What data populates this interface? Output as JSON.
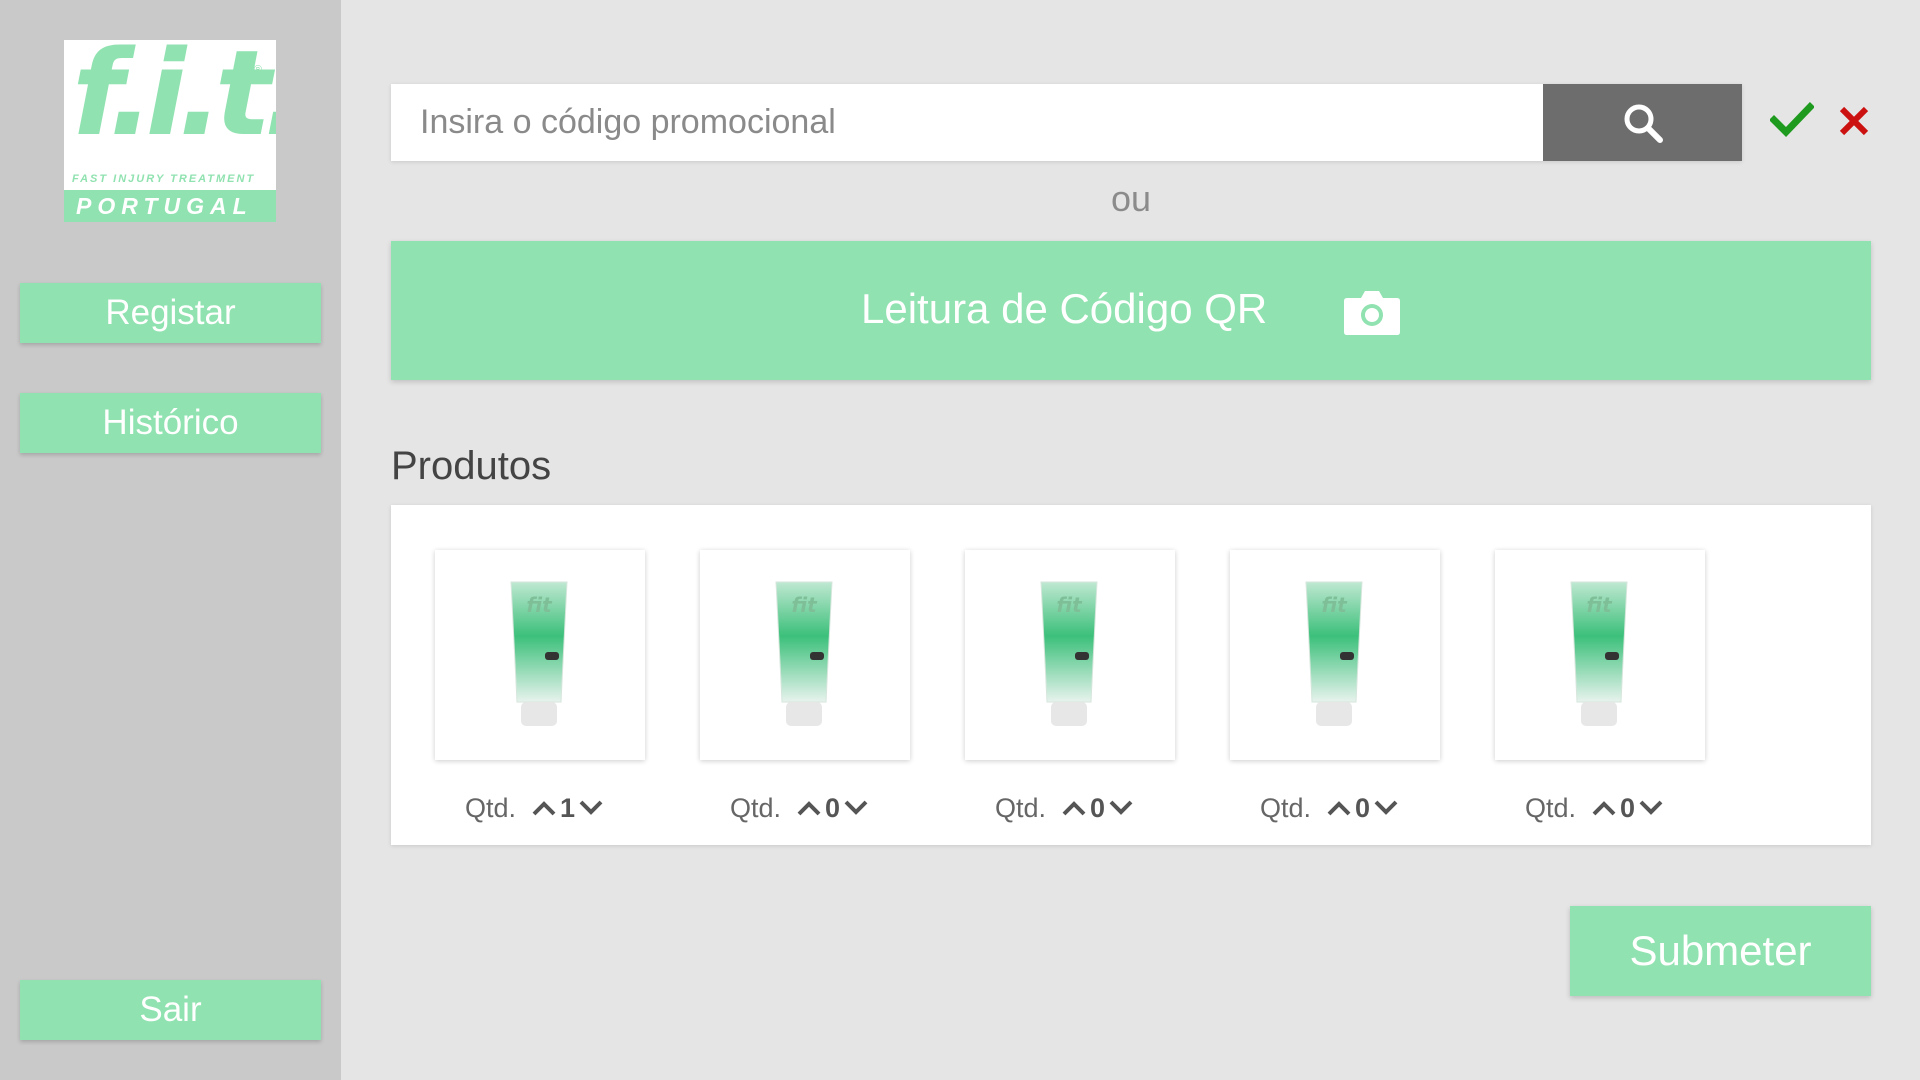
{
  "brand": {
    "logo_text": "f.i.t.",
    "registered_mark": "®",
    "tagline": "FAST INJURY TREATMENT",
    "country": "PORTUGAL",
    "color": "#90e2b0"
  },
  "sidebar": {
    "items": [
      {
        "label": "Registar"
      },
      {
        "label": "Histórico"
      }
    ],
    "logout_label": "Sair"
  },
  "promo": {
    "placeholder": "Insira o código promocional",
    "value": "",
    "search_icon": "search-icon",
    "confirm_icon": "check-icon",
    "cancel_icon": "close-icon"
  },
  "separator": "ou",
  "qr": {
    "label": "Leitura de Código QR",
    "icon": "camera-icon"
  },
  "products": {
    "title": "Produtos",
    "qty_label": "Qtd.",
    "items": [
      {
        "qty": "1"
      },
      {
        "qty": "0"
      },
      {
        "qty": "0"
      },
      {
        "qty": "0"
      },
      {
        "qty": "0"
      }
    ]
  },
  "submit_label": "Submeter",
  "colors": {
    "accent": "#90e2b0",
    "sidebar_bg": "#c9c9c9",
    "page_bg": "#e5e5e5",
    "search_button": "#6d6d6d",
    "confirm": "#1e9a1e",
    "cancel": "#cc1111"
  }
}
